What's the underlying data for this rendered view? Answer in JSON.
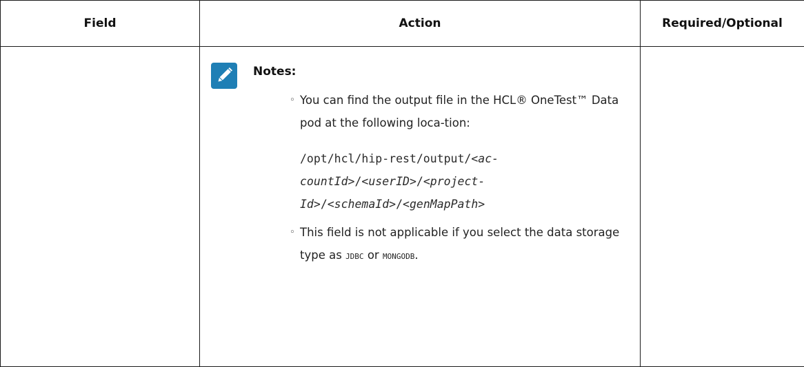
{
  "table": {
    "headers": [
      "Field",
      "Action",
      "Required/Optional"
    ],
    "row": {
      "field": "",
      "required_optional": "",
      "notes": {
        "icon": "note-edit-icon",
        "label": "Notes:",
        "item1_text": "You can find the output file in the HCL® OneTest™ Data pod at the following loca-tion:",
        "path_parts": [
          "/opt/hcl/hip-rest/output/",
          "<ac-countId>",
          "/",
          "<userID>",
          "/",
          "<project-Id>",
          "/",
          "<schemaId>",
          "/",
          "<genMapPath>"
        ],
        "item2_text_a": "This field is not applicable if you select the data storage type as",
        "item2_code_a": "JDBC",
        "item2_text_b": "or",
        "item2_code_b": "MONGODB",
        "item2_text_c": "."
      }
    }
  },
  "colors": {
    "note_icon_bg": "#1f7fb5",
    "border": "#1a1a1a"
  }
}
